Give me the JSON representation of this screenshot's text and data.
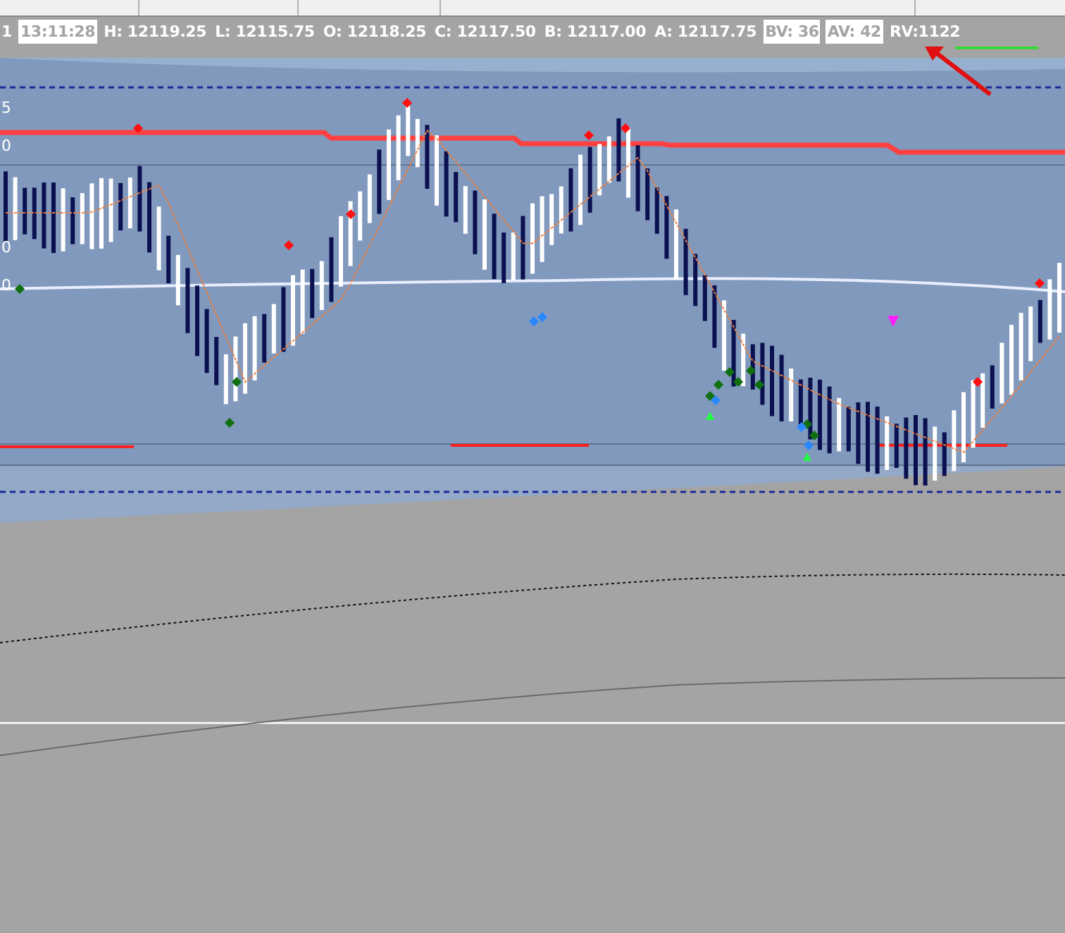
{
  "header": {
    "fields": [
      {
        "text": "1",
        "highlighted": false
      },
      {
        "text": "13:11:28",
        "highlighted": true
      },
      {
        "text": "H: 12119.25",
        "highlighted": false
      },
      {
        "text": "L: 12115.75",
        "highlighted": false
      },
      {
        "text": "O: 12118.25",
        "highlighted": false
      },
      {
        "text": "C: 12117.50",
        "highlighted": false
      },
      {
        "text": "B: 12117.00",
        "highlighted": false
      },
      {
        "text": "A: 12117.75",
        "highlighted": false
      },
      {
        "text": "BV: 36",
        "highlighted": true
      },
      {
        "text": "AV: 42",
        "highlighted": true
      },
      {
        "text": "RV:1122",
        "highlighted": false
      }
    ]
  },
  "price_labels": [
    "5",
    "0",
    "0",
    "0"
  ]
}
